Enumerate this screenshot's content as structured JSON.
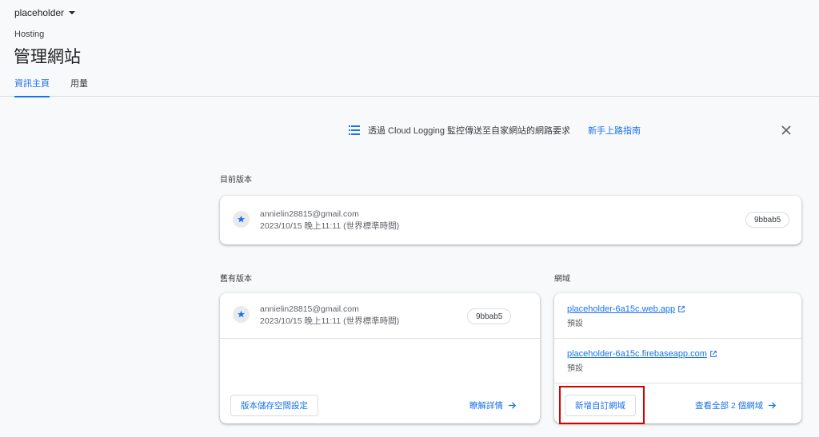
{
  "header": {
    "project": "placeholder",
    "product": "Hosting",
    "title": "管理網站",
    "tabs": [
      {
        "label": "資訊主頁",
        "active": true
      },
      {
        "label": "用量",
        "active": false
      }
    ]
  },
  "banner": {
    "text": "透過 Cloud Logging 監控傳送至自家網站的網路要求",
    "link": "新手上路指南"
  },
  "current_release": {
    "label": "目前版本",
    "email": "annielin28815@gmail.com",
    "time": "2023/10/15 晚上11:11 (世界標準時間)",
    "version": "9bbab5"
  },
  "previous_releases": {
    "label": "舊有版本",
    "email": "annielin28815@gmail.com",
    "time": "2023/10/15 晚上11:11 (世界標準時間)",
    "version": "9bbab5",
    "storage_button": "版本儲存空間設定",
    "learn_more": "瞭解詳情"
  },
  "domains": {
    "label": "網域",
    "items": [
      {
        "url": "placeholder-6a15c.web.app",
        "sub": "預設"
      },
      {
        "url": "placeholder-6a15c.firebaseapp.com",
        "sub": "預設"
      }
    ],
    "add_button": "新增自訂網域",
    "view_all": "查看全部 2 個網域"
  },
  "colors": {
    "accent": "#1a73e8",
    "highlight": "#d50000"
  }
}
